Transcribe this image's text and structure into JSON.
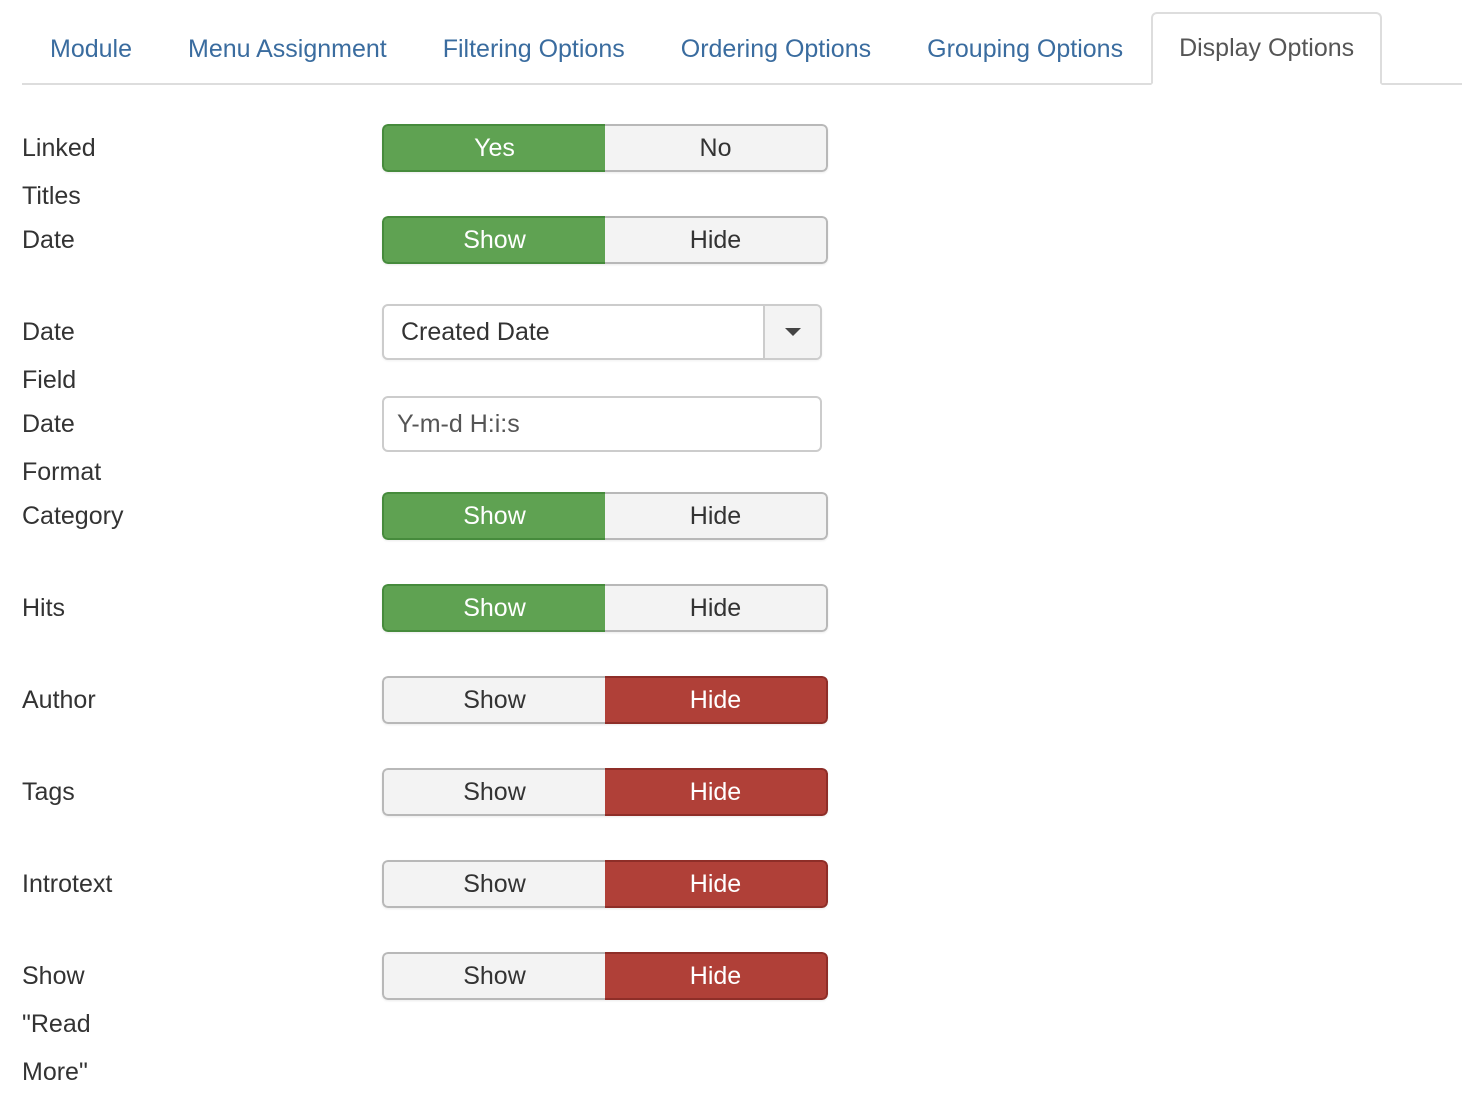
{
  "tabs": [
    {
      "label": "Module",
      "active": false
    },
    {
      "label": "Menu Assignment",
      "active": false
    },
    {
      "label": "Filtering Options",
      "active": false
    },
    {
      "label": "Ordering Options",
      "active": false
    },
    {
      "label": "Grouping Options",
      "active": false
    },
    {
      "label": "Display Options",
      "active": true
    }
  ],
  "colors": {
    "link": "#3a6c9f",
    "on_green": "#5fa252",
    "on_red": "#b04038",
    "off": "#f3f3f3"
  },
  "fields": {
    "linked_titles": {
      "label": "Linked Titles",
      "options": [
        "Yes",
        "No"
      ],
      "selected": "Yes"
    },
    "date": {
      "label": "Date",
      "options": [
        "Show",
        "Hide"
      ],
      "selected": "Show"
    },
    "date_field": {
      "label": "Date Field",
      "value": "Created Date",
      "icon": "caret-down-icon"
    },
    "date_format": {
      "label": "Date Format",
      "value": "Y-m-d H:i:s"
    },
    "category": {
      "label": "Category",
      "options": [
        "Show",
        "Hide"
      ],
      "selected": "Show"
    },
    "hits": {
      "label": "Hits",
      "options": [
        "Show",
        "Hide"
      ],
      "selected": "Show"
    },
    "author": {
      "label": "Author",
      "options": [
        "Show",
        "Hide"
      ],
      "selected": "Hide"
    },
    "tags": {
      "label": "Tags",
      "options": [
        "Show",
        "Hide"
      ],
      "selected": "Hide"
    },
    "introtext": {
      "label": "Introtext",
      "options": [
        "Show",
        "Hide"
      ],
      "selected": "Hide"
    },
    "read_more": {
      "label": "Show \"Read More\"",
      "options": [
        "Show",
        "Hide"
      ],
      "selected": "Hide"
    }
  }
}
